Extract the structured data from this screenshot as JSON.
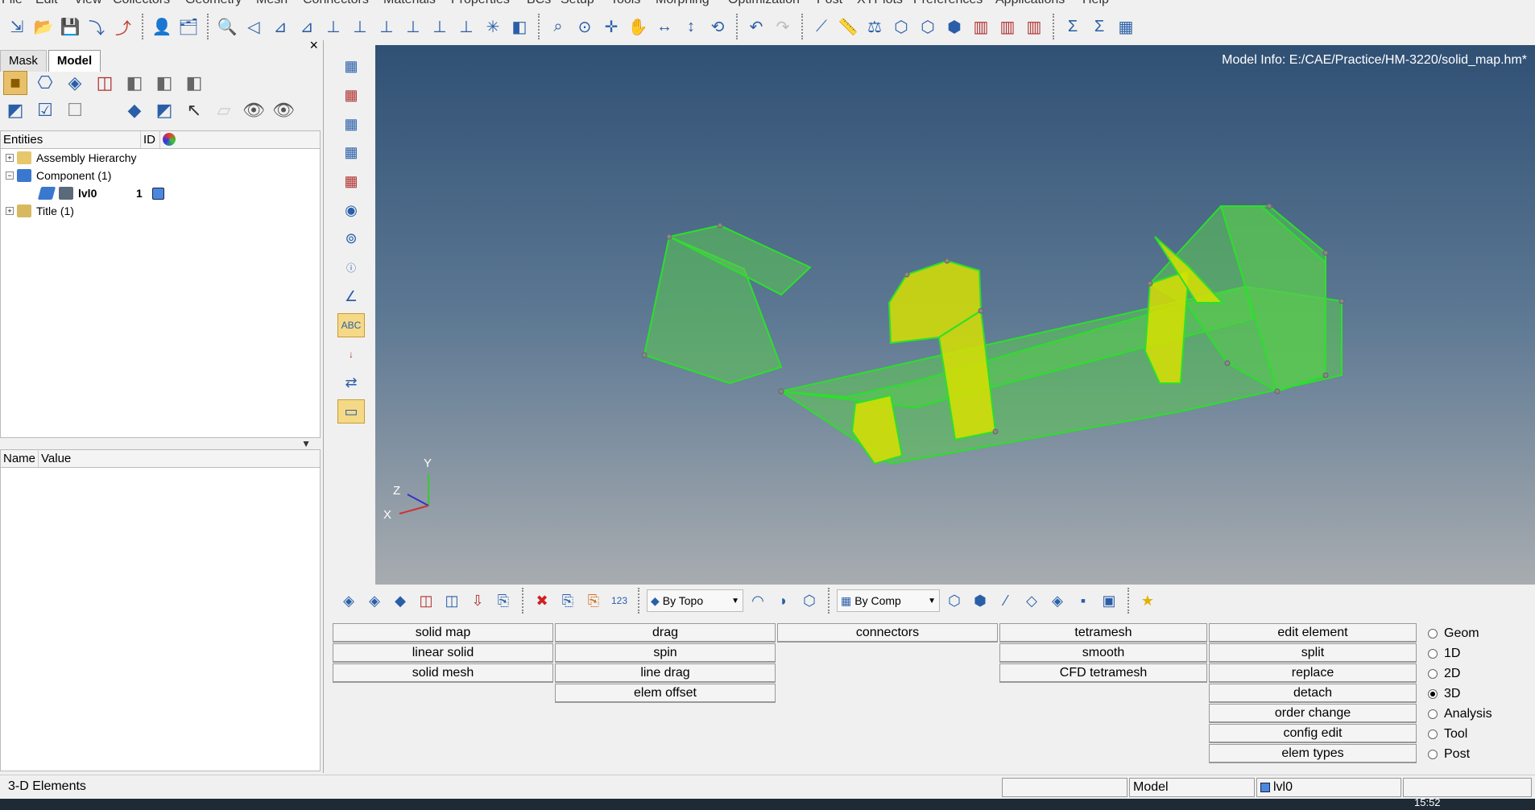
{
  "menubar": {
    "items": [
      "File",
      "Edit",
      "View",
      "Collectors",
      "Geometry",
      "Mesh",
      "Connectors",
      "Materials",
      "Properties",
      "BCs",
      "Setup",
      "Tools",
      "Morphing",
      "Optimization",
      "Post",
      "XYPlots",
      "Preferences",
      "Applications",
      "Help"
    ]
  },
  "leftpanel": {
    "tabs": [
      "Mask",
      "Model"
    ],
    "close": "×",
    "entities_header": {
      "col1": "Entities",
      "col2": "ID"
    },
    "tree": [
      {
        "label": "Assembly Hierarchy",
        "expander": "+"
      },
      {
        "label": "Component (1)",
        "expander": "−"
      },
      {
        "label": "lvl0",
        "id": "1"
      },
      {
        "label": "Title (1)",
        "expander": "+"
      }
    ],
    "props_header": {
      "col1": "Name",
      "col2": "Value"
    }
  },
  "viewport": {
    "model_info": "Model Info: E:/CAE/Practice/HM-3220/solid_map.hm*",
    "triad": {
      "y": "Y",
      "z": "Z",
      "x": "X"
    }
  },
  "bottomtool": {
    "by_topo": "By Topo",
    "by_comp": "By Comp"
  },
  "panel": {
    "col1": [
      "solid map",
      "linear solid",
      "solid mesh"
    ],
    "col2": [
      "drag",
      "spin",
      "line drag",
      "elem offset"
    ],
    "col3": [
      "connectors"
    ],
    "col4": [
      "tetramesh",
      "smooth",
      "CFD tetramesh"
    ],
    "col5": [
      "edit element",
      "split",
      "replace",
      "detach",
      "order change",
      "config edit",
      "elem types"
    ]
  },
  "radios": [
    {
      "label": "Geom",
      "checked": false
    },
    {
      "label": "1D",
      "checked": false
    },
    {
      "label": "2D",
      "checked": false
    },
    {
      "label": "3D",
      "checked": true
    },
    {
      "label": "Analysis",
      "checked": false
    },
    {
      "label": "Tool",
      "checked": false
    },
    {
      "label": "Post",
      "checked": false
    }
  ],
  "statusbar": {
    "left": "3-D Elements",
    "model": "Model",
    "comp": "lvl0"
  },
  "taskbar": {
    "clock": "15:52"
  },
  "colors": {
    "viewport_top": "#305074",
    "viewport_bottom": "#a8acb0",
    "mesh_green": "#2bd62b",
    "mesh_yellow": "#d9e000"
  }
}
